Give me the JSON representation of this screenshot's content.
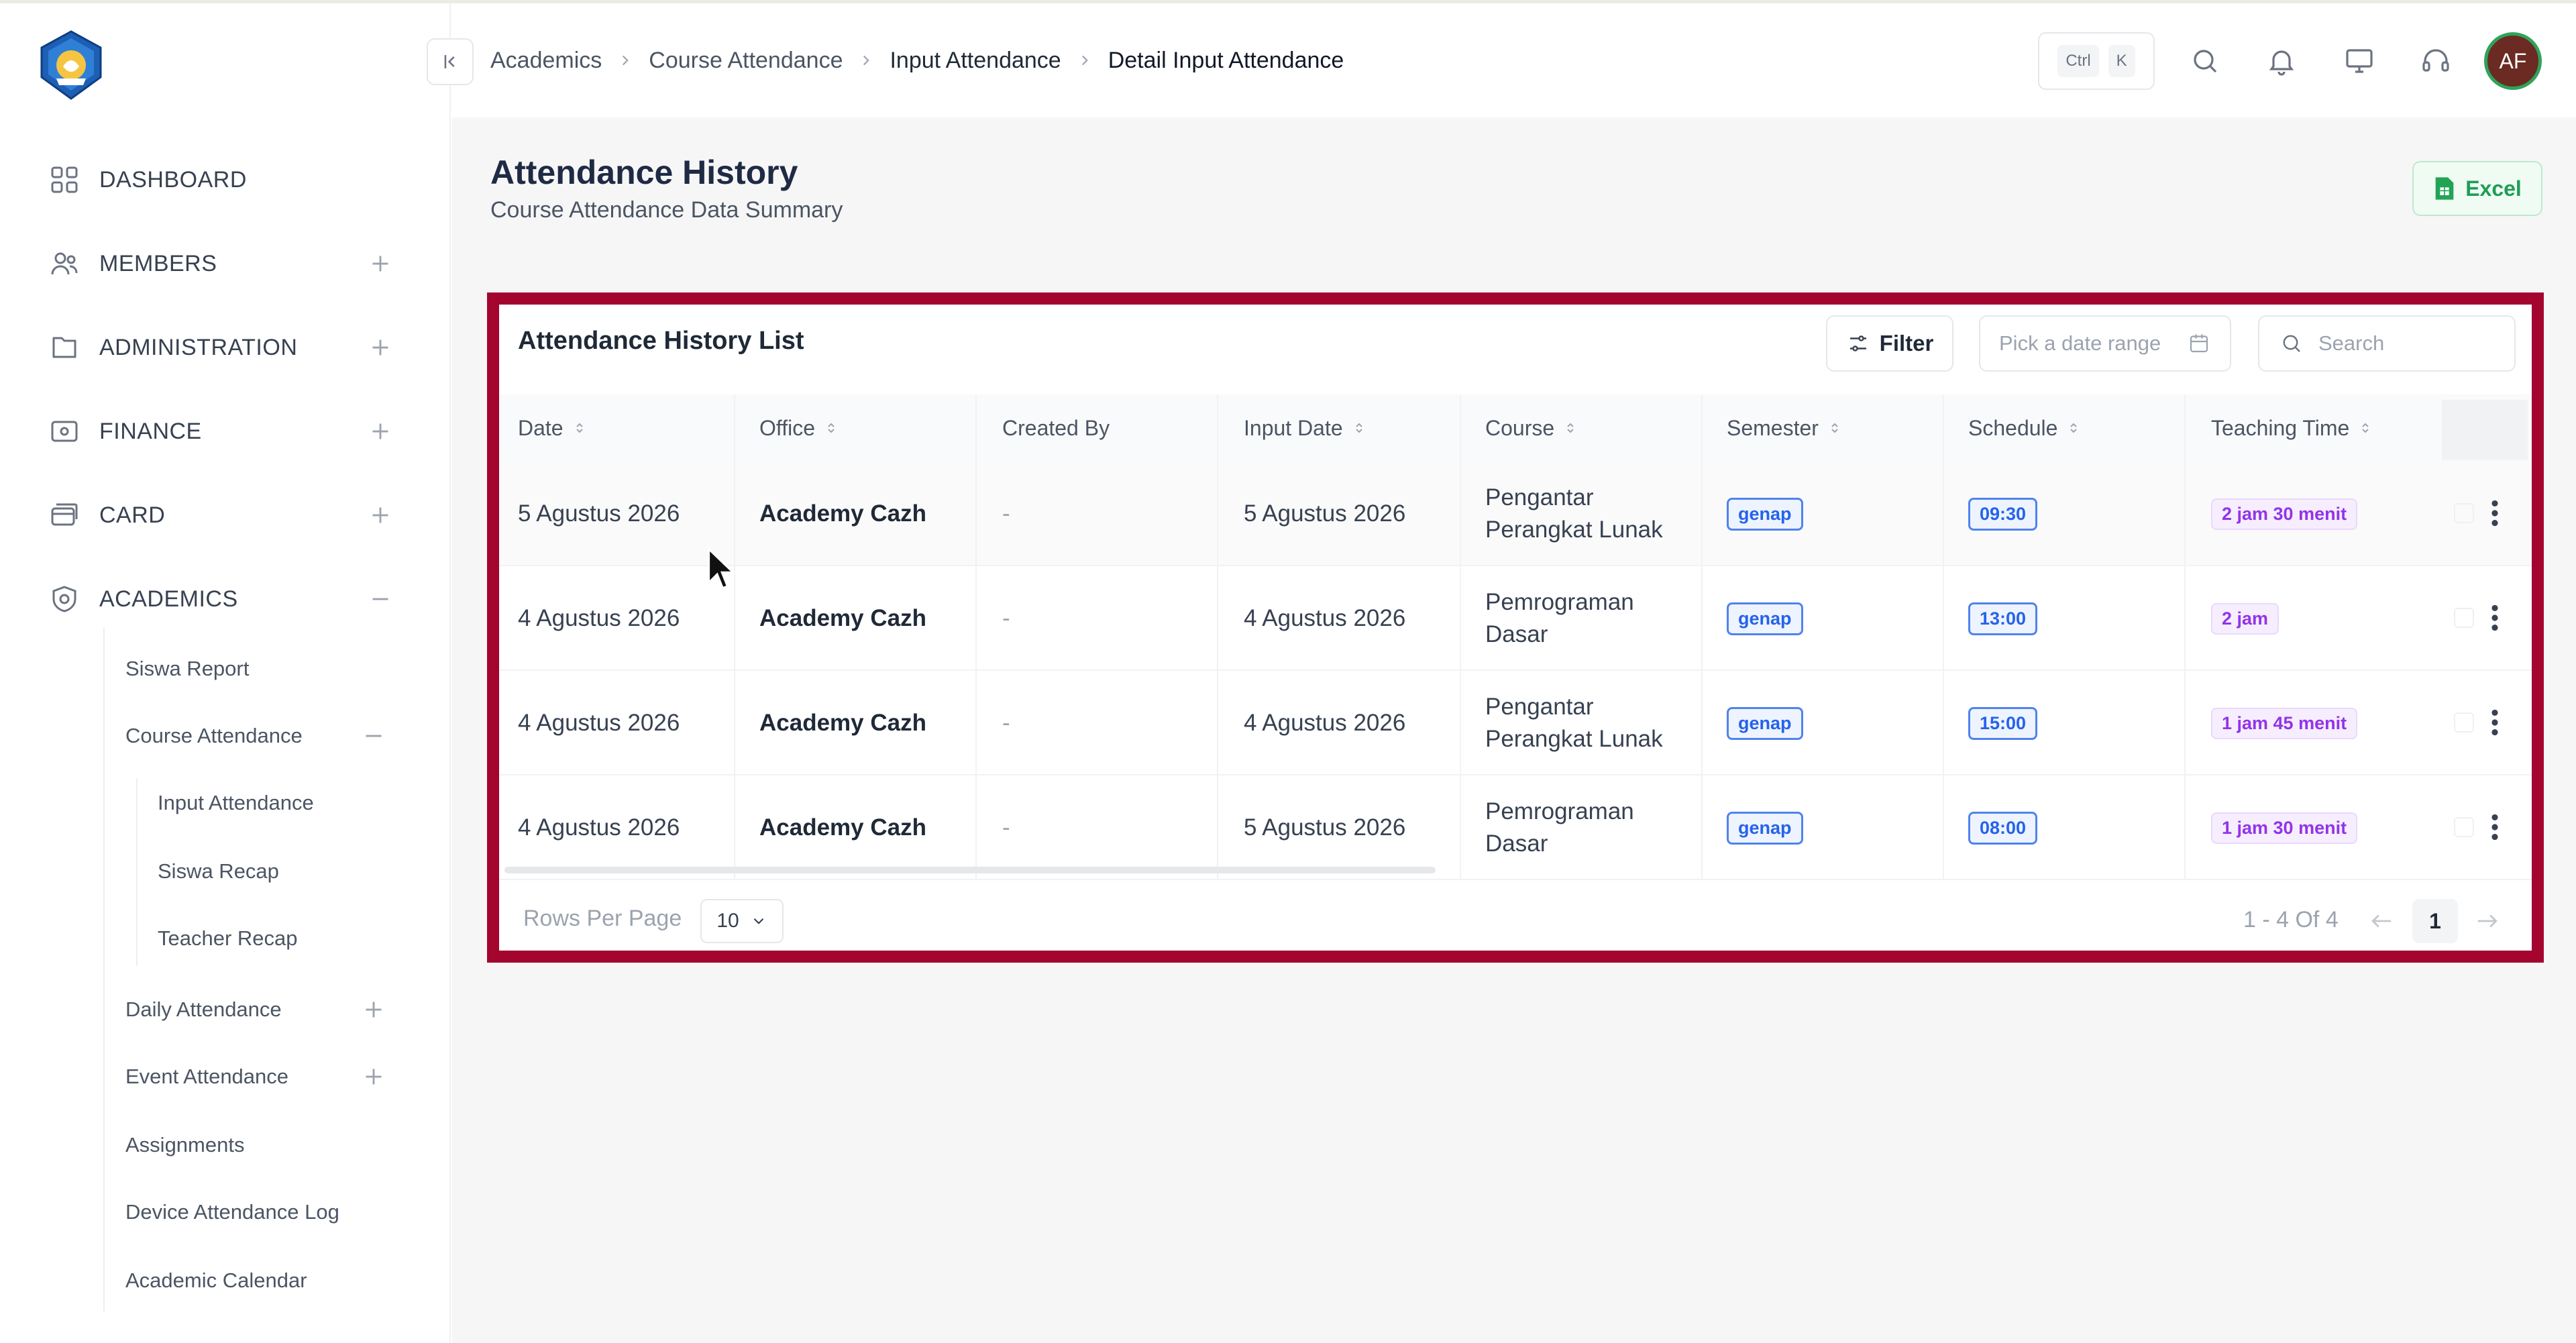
{
  "sidebar": {
    "items": [
      {
        "label": "DASHBOARD",
        "icon": "dashboard-grid-icon"
      },
      {
        "label": "MEMBERS",
        "icon": "users-icon"
      },
      {
        "label": "ADMINISTRATION",
        "icon": "folder-icon"
      },
      {
        "label": "FINANCE",
        "icon": "wallet-icon"
      },
      {
        "label": "CARD",
        "icon": "card-icon"
      },
      {
        "label": "ACADEMICS",
        "icon": "academics-icon"
      }
    ],
    "academics_sub": [
      {
        "label": "Siswa Report"
      },
      {
        "label": "Course Attendance"
      },
      {
        "label": "Input Attendance"
      },
      {
        "label": "Siswa Recap"
      },
      {
        "label": "Teacher Recap"
      },
      {
        "label": "Daily Attendance"
      },
      {
        "label": "Event Attendance"
      },
      {
        "label": "Assignments"
      },
      {
        "label": "Device Attendance Log"
      },
      {
        "label": "Academic Calendar"
      }
    ]
  },
  "header": {
    "breadcrumb": [
      "Academics",
      "Course Attendance",
      "Input Attendance",
      "Detail Input Attendance"
    ],
    "shortcut": {
      "key1": "Ctrl",
      "key2": "K"
    },
    "avatar_initials": "AF"
  },
  "page": {
    "title": "Attendance History",
    "subtitle": "Course Attendance Data Summary",
    "excel_label": "Excel"
  },
  "table": {
    "title": "Attendance History List",
    "filter_label": "Filter",
    "date_placeholder": "Pick a date range",
    "search_placeholder": "Search",
    "columns": [
      "Date",
      "Office",
      "Created By",
      "Input Date",
      "Course",
      "Semester",
      "Schedule",
      "Teaching Time"
    ],
    "rows": [
      {
        "date": "5 Agustus 2026",
        "office": "Academy Cazh",
        "created_by": "-",
        "input_date": "5 Agustus 2026",
        "course_line1": "Pengantar",
        "course_line2": "Perangkat Lunak",
        "semester": "genap",
        "schedule": "09:30",
        "teaching_time": "2 jam 30 menit"
      },
      {
        "date": "4 Agustus 2026",
        "office": "Academy Cazh",
        "created_by": "-",
        "input_date": "4 Agustus 2026",
        "course_line1": "Pemrograman",
        "course_line2": "Dasar",
        "semester": "genap",
        "schedule": "13:00",
        "teaching_time": "2 jam"
      },
      {
        "date": "4 Agustus 2026",
        "office": "Academy Cazh",
        "created_by": "-",
        "input_date": "4 Agustus 2026",
        "course_line1": "Pengantar",
        "course_line2": "Perangkat Lunak",
        "semester": "genap",
        "schedule": "15:00",
        "teaching_time": "1 jam 45 menit"
      },
      {
        "date": "4 Agustus 2026",
        "office": "Academy Cazh",
        "created_by": "-",
        "input_date": "5 Agustus 2026",
        "course_line1": "Pemrograman",
        "course_line2": "Dasar",
        "semester": "genap",
        "schedule": "08:00",
        "teaching_time": "1 jam 30 menit"
      }
    ],
    "rows_per_page_label": "Rows Per Page",
    "rows_per_page_value": "10",
    "page_info": "1 - 4 Of 4",
    "current_page": "1"
  },
  "colors": {
    "highlight_border": "#a3052f",
    "badge_blue": "#2563eb",
    "badge_purple": "#9333ea",
    "excel_green": "#1f9d55"
  }
}
